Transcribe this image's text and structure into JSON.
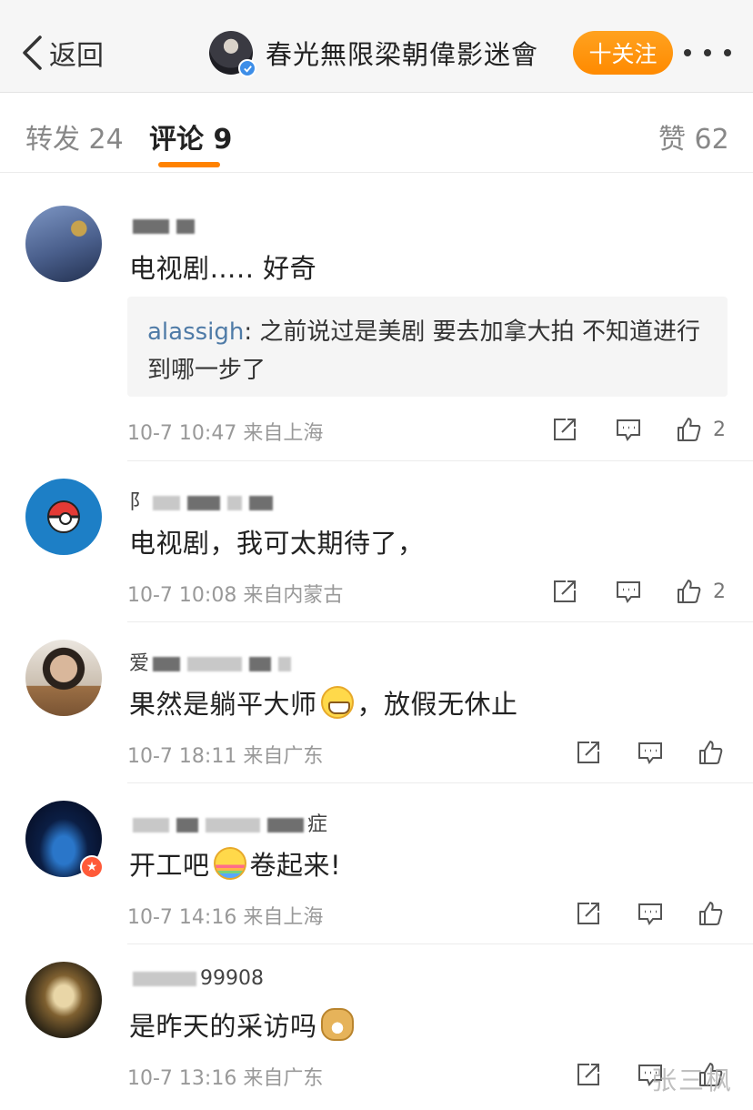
{
  "header": {
    "back_label": "返回",
    "account_name": "春光無限梁朝偉影迷會",
    "follow_label": "十关注"
  },
  "tabs": [
    {
      "label": "转发 24",
      "active": false
    },
    {
      "label": "评论 9",
      "active": true
    },
    {
      "label": "赞 62",
      "active": false
    }
  ],
  "comments": [
    {
      "user": "",
      "text": "电视剧….. 好奇",
      "reply": {
        "user": "alassigh",
        "text": ": 之前说过是美剧 要去加拿大拍 不知道进行到哪一步了"
      },
      "time": "10-7 10:47",
      "source": "来自上海",
      "likes": "2"
    },
    {
      "user": "阝",
      "text": "电视剧，我可太期待了，",
      "time": "10-7 10:08",
      "source": "来自内蒙古",
      "likes": "2"
    },
    {
      "user": "爱",
      "text_before": "果然是躺平大师",
      "text_after": "，放假无休止",
      "emoji": "grin-emoji",
      "time": "10-7 18:11",
      "source": "来自广东",
      "likes": ""
    },
    {
      "user": "症",
      "text_before": "开工吧",
      "text_after": "卷起来!",
      "emoji": "rainbow-emoji",
      "time": "10-7 14:16",
      "source": "来自上海",
      "likes": ""
    },
    {
      "user": "99908",
      "text_before": "是昨天的采访吗",
      "emoji": "doge-emoji",
      "time": "10-7 13:16",
      "source": "来自广东",
      "likes": ""
    }
  ],
  "watermark": "张三枫",
  "colors": {
    "accent": "#ff8200",
    "link": "#4f7ba7",
    "verified": "#3d8ee8"
  }
}
